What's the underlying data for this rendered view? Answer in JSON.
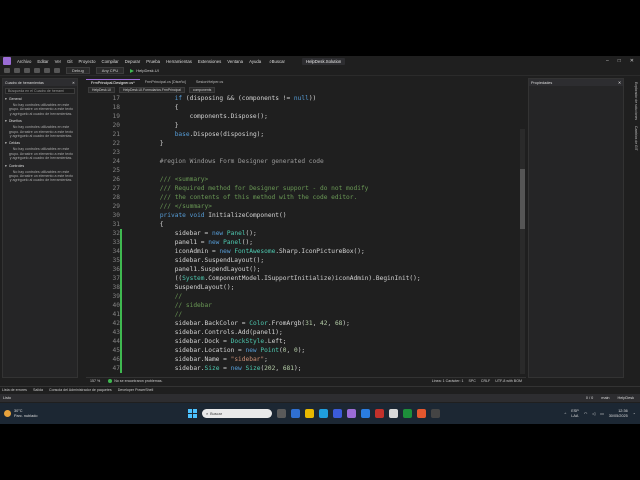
{
  "menubar": {
    "items": [
      "Archivo",
      "Editar",
      "Ver",
      "Git",
      "Proyecto",
      "Compilar",
      "Depurar",
      "Prueba",
      "Herramientas",
      "Extensiones",
      "Ventana",
      "Ayuda"
    ],
    "search_label": "Buscar",
    "solution": "HelpDesk.Solution"
  },
  "toolbar": {
    "config": "Debug",
    "platform": "Any CPU",
    "run_target": "HelpDesk.UI"
  },
  "left_panel": {
    "title": "Cuadro de herramientas",
    "search_placeholder": "Búsqueda en el Cuadro de herrami",
    "groups": [
      {
        "title": "General",
        "message": "No hay controles utilizables en este grupo. Arrastre un elemento a este texto y agréguelo al cuadro de herramientas."
      },
      {
        "title": "Diseños",
        "message": "No hay controles utilizables en este grupo. Arrastre un elemento a este texto y agréguelo al cuadro de herramientas."
      },
      {
        "title": "Celdas",
        "message": "No hay controles utilizables en este grupo. Arrastre un elemento a este texto y agréguelo al cuadro de herramientas."
      },
      {
        "title": "Controles",
        "message": "No hay controles utilizables en este grupo. Arrastre un elemento a este texto y agréguelo al cuadro de herramientas."
      }
    ]
  },
  "tabs": [
    "FrmPrincipal.Designer.cs*",
    "FrmPrincipal.cs [Diseño]",
    "SesionHelper.cs"
  ],
  "navbar": {
    "project": "HelpDesk.UI",
    "class": "HelpDesk.UI.Formularios.FrmPrincipal",
    "member": "components"
  },
  "code_lines": [
    {
      "n": "17",
      "t": "            if (disposing && (components != null))",
      "chg": false
    },
    {
      "n": "18",
      "t": "            {",
      "chg": false
    },
    {
      "n": "19",
      "t": "                components.Dispose();",
      "chg": false
    },
    {
      "n": "20",
      "t": "            }",
      "chg": false
    },
    {
      "n": "21",
      "t": "            base.Dispose(disposing);",
      "chg": false
    },
    {
      "n": "22",
      "t": "        }",
      "chg": false
    },
    {
      "n": "23",
      "t": "",
      "chg": false
    },
    {
      "n": "24",
      "t": "        #region Windows Form Designer generated code",
      "chg": false
    },
    {
      "n": "25",
      "t": "",
      "chg": false
    },
    {
      "n": "26",
      "t": "        /// <summary>",
      "chg": false
    },
    {
      "n": "27",
      "t": "        /// Required method for Designer support - do not modify",
      "chg": false
    },
    {
      "n": "28",
      "t": "        /// the contents of this method with the code editor.",
      "chg": false
    },
    {
      "n": "29",
      "t": "        /// </summary>",
      "chg": false
    },
    {
      "n": "30",
      "t": "        private void InitializeComponent()",
      "chg": false
    },
    {
      "n": "31",
      "t": "        {",
      "chg": false
    },
    {
      "n": "32",
      "t": "            sidebar = new Panel();",
      "chg": true
    },
    {
      "n": "33",
      "t": "            panel1 = new Panel();",
      "chg": true
    },
    {
      "n": "34",
      "t": "            iconAdmin = new FontAwesome.Sharp.IconPictureBox();",
      "chg": true
    },
    {
      "n": "35",
      "t": "            sidebar.SuspendLayout();",
      "chg": true
    },
    {
      "n": "36",
      "t": "            panel1.SuspendLayout();",
      "chg": true
    },
    {
      "n": "37",
      "t": "            ((System.ComponentModel.ISupportInitialize)iconAdmin).BeginInit();",
      "chg": true
    },
    {
      "n": "38",
      "t": "            SuspendLayout();",
      "chg": true
    },
    {
      "n": "39",
      "t": "            //",
      "chg": true
    },
    {
      "n": "40",
      "t": "            // sidebar",
      "chg": true
    },
    {
      "n": "41",
      "t": "            //",
      "chg": true
    },
    {
      "n": "42",
      "t": "            sidebar.BackColor = Color.FromArgb(31, 42, 68);",
      "chg": true
    },
    {
      "n": "43",
      "t": "            sidebar.Controls.Add(panel1);",
      "chg": true
    },
    {
      "n": "44",
      "t": "            sidebar.Dock = DockStyle.Left;",
      "chg": true
    },
    {
      "n": "45",
      "t": "            sidebar.Location = new Point(0, 0);",
      "chg": true
    },
    {
      "n": "46",
      "t": "            sidebar.Name = \"sidebar\";",
      "chg": true
    },
    {
      "n": "47",
      "t": "            sidebar.Size = new Size(202, 681);",
      "chg": true
    }
  ],
  "statusline": {
    "zoom": "157 %",
    "issues": "No se encontraron problemas.",
    "position": "Línea: 1   Carácter: 1",
    "spc": "SPC",
    "eol": "CRLF",
    "encoding": "UTF-8 with BOM"
  },
  "right_panel": {
    "title": "Propiedades"
  },
  "vertical_tabs": [
    "Explorador de soluciones",
    "Cambios de GIT"
  ],
  "bottom_tabs": [
    "Lista de errores",
    "Salida",
    "Consola del Administrador de paquetes",
    "Developer PowerShell"
  ],
  "vs_status": {
    "left": "Listo",
    "changes": "0 / 0",
    "branch": "main",
    "project": "HelpDesk"
  },
  "taskbar": {
    "temp": "30°C",
    "weather": "Parc. nublado",
    "search": "Buscar",
    "lang": "ESP",
    "lang2": "LAA",
    "time": "12:36",
    "date": "30/05/2025"
  },
  "colors": {
    "accent": "#9b6cd6",
    "keyword": "#569cd6",
    "type": "#4ec9b0",
    "comment": "#6a9955",
    "string": "#ce9178",
    "method": "#dcdcaa",
    "number": "#b5cea8",
    "region": "#9b9b9b"
  }
}
